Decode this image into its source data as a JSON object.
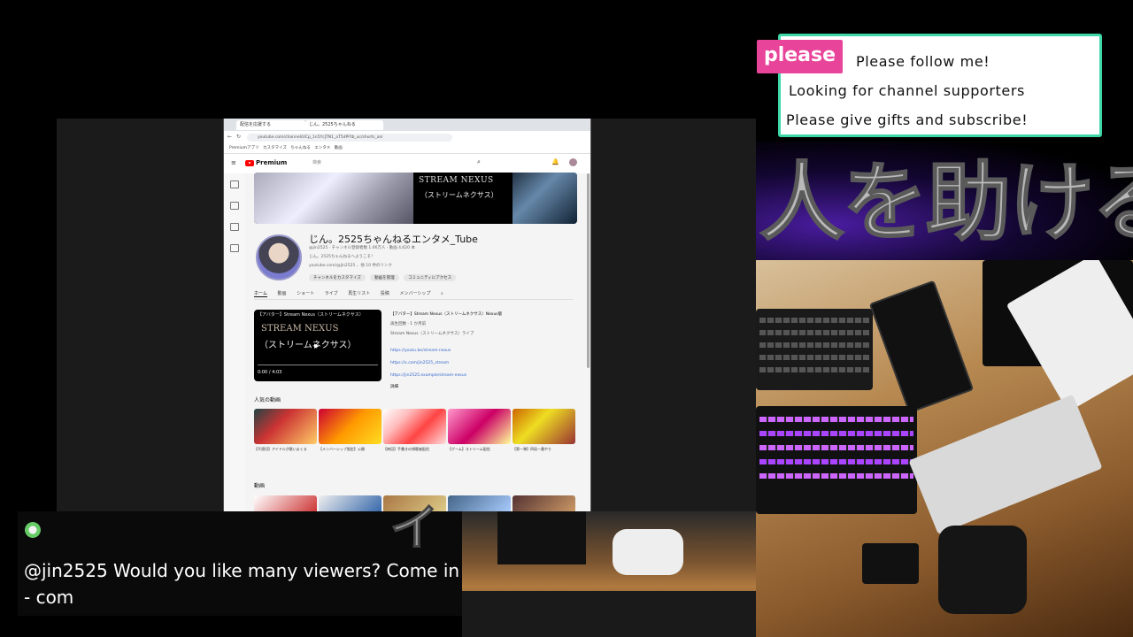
{
  "stream_overlay": {
    "please_badge": "please",
    "follow_lines": [
      "Please follow me!",
      "Looking for channel supporters",
      "Please give gifts and subscribe!"
    ],
    "big_text": "人を助ける",
    "overlay_katakana": "イ"
  },
  "chat": {
    "message": "@jin2525 Would you like many viewers? Come in - com"
  },
  "browser": {
    "tabs": [
      "配信を応援する",
      "じん。2525ちゃんねる"
    ],
    "url": "youtube.com/channel/UCp_1n5YcJTN1_aT5dPFtb_uc/shorts_ani",
    "bookmarks": "Premiumアプリ　カスタマイズ　ちゃんねる　エンタメ　動画",
    "youtube": {
      "logo": "Premium",
      "search_placeholder": "検索",
      "banner_title": "STREAM NEXUS",
      "banner_subtitle": "（ストリームネクサス）",
      "channel_name": "じん。2525ちゃんねるエンタメ_Tube",
      "channel_meta": "@jin2525 · チャンネル登録者数 1.06万人 · 動画 4,620 本",
      "channel_desc": "じん。2525ちゃんねるへようこそ！",
      "channel_links": "youtube.com/@jin2525 、他 10 件のリンク",
      "buttons": [
        "チャンネルをカスタマイズ",
        "動画を管理",
        "コミュニティにアクセス"
      ],
      "tabs": [
        "ホーム",
        "動画",
        "ショート",
        "ライブ",
        "再生リスト",
        "投稿",
        "メンバーシップ"
      ],
      "featured_video": {
        "title": "【アバター】Stream Nexus（ストリームネクサス）",
        "line1": "STREAM NEXUS",
        "line2": "（ストリームネクサス）",
        "time": "0:00 / 4:03"
      },
      "video_desc": [
        "【アバター】Stream Nexus（ストリームネクサス）Nexus版",
        "再生回数 · 1 か月前",
        "Stream Nexus（ストリームネクサス）ライブ",
        "https://youtu.be/stream-nexus",
        "https://x.com/jin2525_stream",
        "https://jin2525.example/stream-nexus",
        "詳細"
      ],
      "popular_title": "人気の動画",
      "videos_title": "動画",
      "popular_captions": [
        "【不適切】アイドルが歌いまくる",
        "【メンバーシップ限定】公開",
        "【神回】手書きの視聴者配信",
        "【ゲーム】ストリーム配信",
        "【第一弾】四局一番やり"
      ]
    }
  },
  "colors": {
    "please_badge": "#e8459a",
    "follow_border": "#3ed8a8",
    "big_text_glow": "#4a1ca0"
  }
}
